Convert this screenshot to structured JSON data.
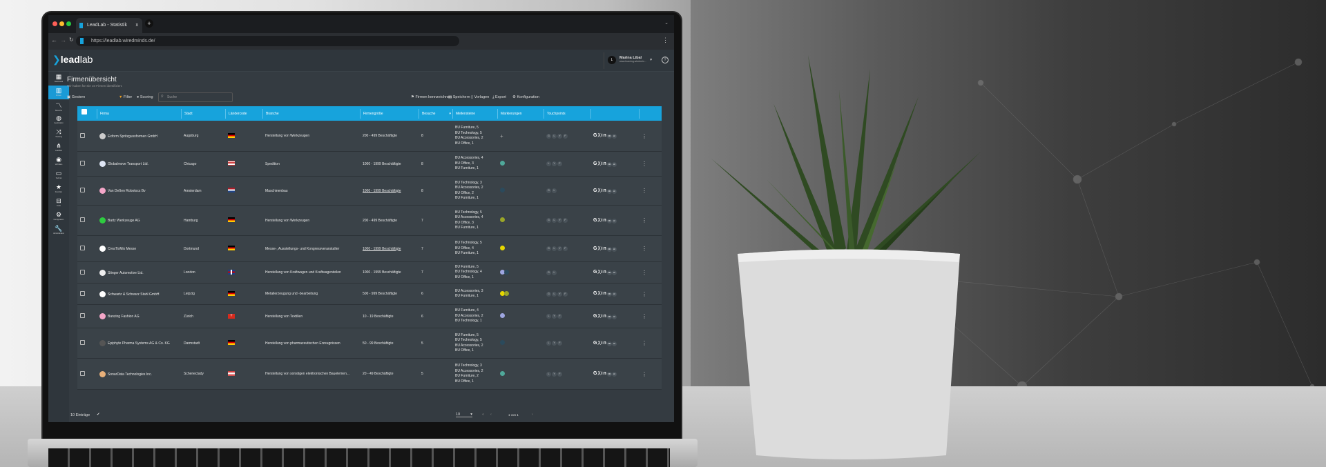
{
  "browser": {
    "tab_title": "LeadLab - Statistik",
    "tab_close": "x",
    "new_tab": "+",
    "url": "https://leadlab.wiredminds.de/"
  },
  "app": {
    "logo_bold": "lead",
    "logo_light": "lab",
    "user_initial": "L",
    "user_name": "Marina Libal",
    "user_sub": "www.learning.wiredmin...",
    "help": "?"
  },
  "sidebar": {
    "items": [
      {
        "label": "Dashboard",
        "icon": "dashboard-icon",
        "glyph": "▦"
      },
      {
        "label": "Firmen",
        "icon": "companies-icon",
        "glyph": "▥",
        "active": true
      },
      {
        "label": "Besuche",
        "icon": "visits-icon",
        "glyph": "〽"
      },
      {
        "label": "Geolocation",
        "icon": "globe-icon",
        "glyph": "◍"
      },
      {
        "label": "Tracking",
        "icon": "tracking-icon",
        "glyph": "⤨"
      },
      {
        "label": "Leadflow",
        "icon": "flow-icon",
        "glyph": "⋔"
      },
      {
        "label": "Verhalten",
        "icon": "behavior-icon",
        "glyph": "◉"
      },
      {
        "label": "Technik",
        "icon": "devices-icon",
        "glyph": "▭"
      },
      {
        "label": "Favoriten",
        "icon": "star-icon",
        "glyph": "★"
      },
      {
        "label": "Tools",
        "icon": "toolbox-icon",
        "glyph": "⊟"
      },
      {
        "label": "Konfiguration",
        "icon": "gear-icon",
        "glyph": "⚙"
      },
      {
        "label": "Administration",
        "icon": "wrench-icon",
        "glyph": "🔧"
      }
    ]
  },
  "page": {
    "title": "Firmenübersicht",
    "subtitle": "Wir haben für Sie 10 Firmen identifiziert.",
    "date_filter": "Gestern",
    "filter": "Filter",
    "scoring": "Scoring",
    "search_placeholder": "Suche",
    "actions": [
      "Firmen kennzeichnen",
      "Speichern",
      "Vorlagen",
      "Export",
      "Konfiguration"
    ]
  },
  "table": {
    "columns": [
      "Firma",
      "Stadt",
      "Ländercode",
      "Branche",
      "Firmengröße",
      "Besuche",
      "Meilensteine",
      "Markierungen",
      "Touchpoints"
    ],
    "sort_indicator": "▾",
    "social": {
      "g": "G",
      "x": "ᚷ",
      "in": "in",
      "nd": "ND",
      "ai": "AI"
    },
    "rows": [
      {
        "firma": "Exform Spritzgussformen GmbH",
        "stadt": "Augsburg",
        "land": "de",
        "branche": "Herstellung von Werkzeugen",
        "groesse": "200 - 499 Beschäftigte",
        "besuche": "8",
        "meilensteine": [
          "BU Furniture, 5",
          "BU Technology, 5",
          "BU Accessories, 2",
          "BU Office, 1"
        ],
        "markierungen": [],
        "add_marker": "+",
        "touchpoints": [
          "G",
          "L",
          "Y",
          "F"
        ]
      },
      {
        "firma": "Globalmove Transport Ltd.",
        "stadt": "Chicago",
        "land": "us",
        "branche": "Spedition",
        "groesse": "1000 - 1999 Beschäftigte",
        "besuche": "8",
        "meilensteine": [
          "BU Accessories, 4",
          "BU Office, 3",
          "BU Furniture, 1"
        ],
        "markierungen": [
          "#4fa89a"
        ],
        "touchpoints": [
          "L",
          "Y",
          "F"
        ]
      },
      {
        "firma": "Van Deßen Robotocs Bv",
        "stadt": "Amsterdam",
        "land": "nl",
        "branche": "Maschinenbau",
        "groesse": "1000 - 1999 Beschäftigte",
        "besuche": "8",
        "meilensteine": [
          "BU Technology, 3",
          "BU Accessories, 2",
          "BU Office, 2",
          "BU Furniture, 1"
        ],
        "markierungen": [
          "#2b4a5c"
        ],
        "touchpoints": [
          "G",
          "L"
        ]
      },
      {
        "firma": "Bartz Werkzeuge AG",
        "stadt": "Hamburg",
        "land": "de",
        "branche": "Herstellung von Werkzeugen",
        "groesse": "200 - 499 Beschäftigte",
        "besuche": "7",
        "meilensteine": [
          "BU Technology, 5",
          "BU Accessories, 4",
          "BU Office, 3",
          "BU Furniture, 1"
        ],
        "markierungen": [
          "#9aa628"
        ],
        "touchpoints": [
          "G",
          "L",
          "Y",
          "F"
        ]
      },
      {
        "firma": "CreaTixMix Messe",
        "stadt": "Dortmund",
        "land": "de",
        "branche": "Messe-, Ausstellungs- und Kongressveranstalter",
        "groesse": "1000 - 1999 Beschäftigte",
        "besuche": "7",
        "meilensteine": [
          "BU Technology, 5",
          "BU Office, 4",
          "BU Furniture, 1"
        ],
        "markierungen": [
          "#e6d700"
        ],
        "touchpoints": [
          "G",
          "L",
          "Y",
          "F"
        ]
      },
      {
        "firma": "Stinger Automotive Ltd.",
        "stadt": "London",
        "land": "gb",
        "branche": "Herstellung von Kraftwagen und Kraftwagenteilen",
        "groesse": "1000 - 1999 Beschäftigte",
        "besuche": "7",
        "meilensteine": [
          "BU Furniture, 5",
          "BU Technology, 4",
          "BU Office, 1"
        ],
        "markierungen": [
          "#9ea6e0",
          "#2b4a5c"
        ],
        "touchpoints": [
          "G",
          "L"
        ]
      },
      {
        "firma": "Schwartz & Schwarz Stahl GmbH",
        "stadt": "Leipzig",
        "land": "de",
        "branche": "Metallerzeugung und -bearbeitung",
        "groesse": "500 - 999 Beschäftigte",
        "besuche": "6",
        "meilensteine": [
          "BU Accessories, 3",
          "BU Furniture, 1"
        ],
        "markierungen": [
          "#e6d700",
          "#9aa628"
        ],
        "touchpoints": [
          "G",
          "L",
          "Y",
          "F"
        ]
      },
      {
        "firma": "Banzing Fashion AG",
        "stadt": "Zürich",
        "land": "ch",
        "branche": "Herstellung von Textilien",
        "groesse": "10 - 19 Beschäftigte",
        "besuche": "6",
        "meilensteine": [
          "BU Furniture, 4",
          "BU Accessories, 2",
          "BU Technology, 1"
        ],
        "markierungen": [
          "#9ea6e0"
        ],
        "touchpoints": [
          "L",
          "Y",
          "F"
        ]
      },
      {
        "firma": "Epiphyte Pharma Systems AG & Co. KG",
        "stadt": "Darmstadt",
        "land": "de",
        "branche": "Herstellung von pharmazeutischen Erzeugnissen",
        "groesse": "50 - 99 Beschäftigte",
        "besuche": "5",
        "meilensteine": [
          "BU Furniture, 5",
          "BU Technology, 5",
          "BU Accessories, 2",
          "BU Office, 1"
        ],
        "markierungen": [
          "#2b4a5c"
        ],
        "touchpoints": [
          "L",
          "Y",
          "F"
        ]
      },
      {
        "firma": "SonarData Technologies Inc.",
        "stadt": "Schenectady",
        "land": "us",
        "branche": "Herstellung von sonstigen elektronischen Bauelemen...",
        "groesse": "20 - 49 Beschäftigte",
        "besuche": "5",
        "meilensteine": [
          "BU Technology, 3",
          "BU Accessories, 2",
          "BU Furniture, 2",
          "BU Office, 1"
        ],
        "markierungen": [
          "#4fa89a"
        ],
        "touchpoints": [
          "L",
          "Y",
          "F"
        ]
      }
    ]
  },
  "footer": {
    "entries": "10 Einträge",
    "page_size": "10",
    "page_info": "1 von 1"
  },
  "colors": {
    "accent": "#17a3dc",
    "panel": "#3a4248"
  }
}
